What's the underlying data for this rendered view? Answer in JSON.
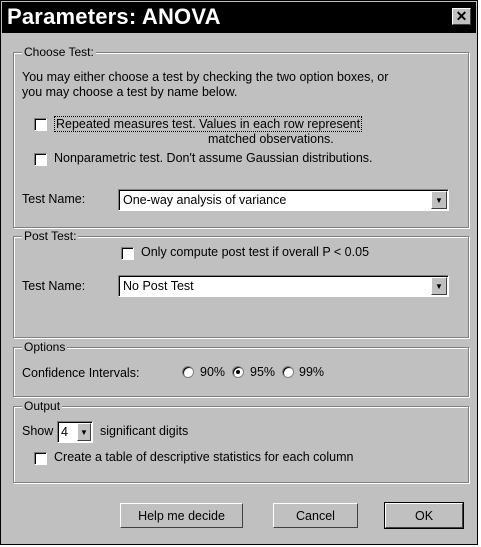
{
  "window": {
    "title": "Parameters: ANOVA"
  },
  "choose_test": {
    "legend": "Choose Test:",
    "intro_line1": "You may either choose a test by checking the two option boxes, or",
    "intro_line2": "you may choose a test by name below.",
    "repeated_label_line1": "Repeated measures test. Values in each row represent",
    "repeated_label_line2": "matched observations.",
    "repeated_checked": false,
    "nonparam_label": "Nonparametric test. Don't assume Gaussian distributions.",
    "nonparam_checked": false,
    "test_name_label": "Test Name:",
    "test_name_value": "One-way analysis of variance"
  },
  "post_test": {
    "legend": "Post Test:",
    "only_if_label": "Only compute post test if overall P < 0.05",
    "only_if_checked": false,
    "test_name_label": "Test Name:",
    "test_name_value": "No Post Test"
  },
  "options": {
    "legend": "Options",
    "ci_label": "Confidence Intervals:",
    "ci_choices": [
      "90%",
      "95%",
      "99%"
    ],
    "ci_selected": "95%"
  },
  "output": {
    "legend": "Output",
    "show_label": "Show",
    "digits_value": "4",
    "digits_suffix": "significant digits",
    "table_label": "Create a table of descriptive statistics for each column",
    "table_checked": false
  },
  "buttons": {
    "help": "Help me decide",
    "cancel": "Cancel",
    "ok": "OK"
  }
}
